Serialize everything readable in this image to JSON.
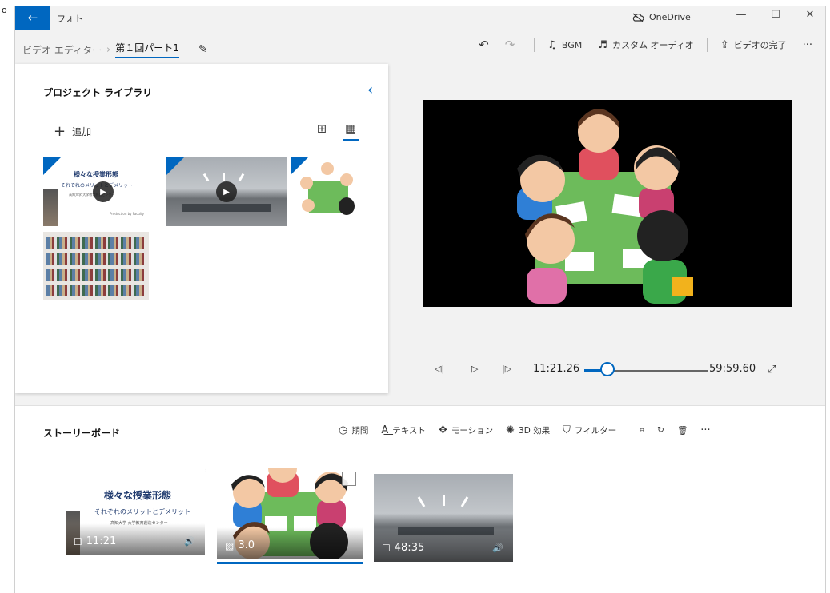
{
  "window": {
    "app_title": "フォト",
    "onedrive_label": "OneDrive",
    "stray_char": "o"
  },
  "icons": {
    "back": "←",
    "minimize": "—",
    "maximize": "☐",
    "close": "✕",
    "undo": "↶",
    "redo": "↷",
    "music": "♫",
    "custom_audio": "♬",
    "export": "⇪",
    "more": "···",
    "pencil": "✎",
    "collapse": "‹",
    "plus": "+",
    "grid_small": "⊞",
    "grid_large": "▦",
    "play": "▶",
    "prev_frame": "◁|",
    "play_main": "▷",
    "next_frame": "|▷",
    "fullscreen": "⤢",
    "clock": "◷",
    "text": "A͟",
    "motion": "✥",
    "effects": "✺",
    "filter": "⛉",
    "crop": "⌗",
    "rotate": "↻",
    "delete": "🗑",
    "video": "☐",
    "image": "▨",
    "volume": "🔊"
  },
  "toolbar": {
    "breadcrumb_parent": "ビデオ エディター",
    "breadcrumb_sep": "›",
    "breadcrumb_current": "第１回パート1",
    "bgm": "BGM",
    "custom_audio": "カスタム オーディオ",
    "finish_video": "ビデオの完了"
  },
  "library": {
    "title": "プロジェクト ライブラリ",
    "add_label": "追加",
    "slide_title": "様々な授業形態",
    "slide_subtitle": "それぞれのメリットとデメリット",
    "slide_note": "高知大学 大学教育創造センター",
    "slide_footer": "Production by Faculty"
  },
  "playback": {
    "current_time": "11:21.26",
    "total_time": "59:59.60",
    "progress": 0.19
  },
  "storyboard": {
    "title": "ストーリーボード",
    "tools": {
      "duration": "期間",
      "text": "テキスト",
      "motion": "モーション",
      "effects3d": "3D 効果",
      "filter": "フィルター"
    },
    "clips": [
      {
        "duration": "11:21",
        "slide_title": "様々な授業形態",
        "slide_subtitle": "それぞれのメリットとデメリット",
        "slide_note": "高知大学 大学教育創造センター"
      },
      {
        "duration": "3.0"
      },
      {
        "duration": "48:35"
      }
    ]
  },
  "colors": {
    "accent": "#0067c0",
    "table_green": "#6dbb5b"
  }
}
